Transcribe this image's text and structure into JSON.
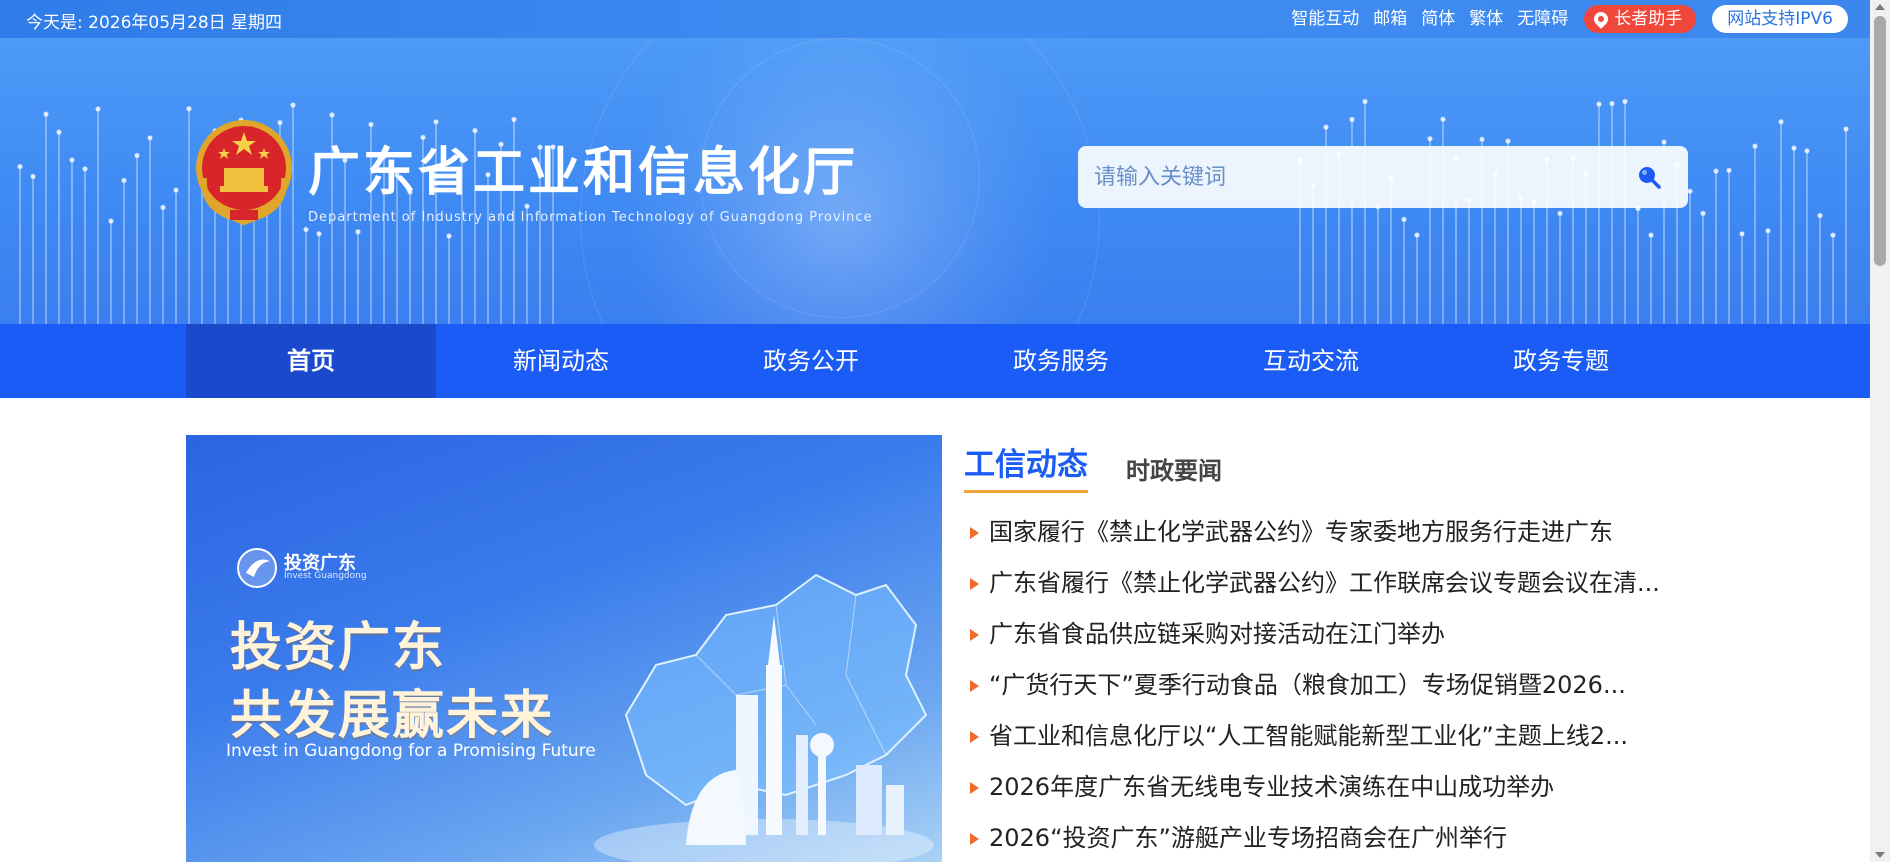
{
  "topbar": {
    "date": "今天是: 2026年05月28日 星期四",
    "links": [
      "智能互动",
      "邮箱",
      "简体",
      "繁体",
      "无障碍"
    ],
    "elder_label": "长者助手",
    "ipv6_label": "网站支持IPV6"
  },
  "header": {
    "title": "广东省工业和信息化厅",
    "subtitle": "Department of Industry and Information Technology of Guangdong Province",
    "search_placeholder": "请输入关键词",
    "search_icon": "search-icon",
    "emblem_icon": "national-emblem-icon"
  },
  "nav": {
    "items": [
      "首页",
      "新闻动态",
      "政务公开",
      "政务服务",
      "互动交流",
      "政务专题"
    ],
    "active_index": 0
  },
  "hero": {
    "logo_cn": "投资广东",
    "logo_en": "Invest Guangdong",
    "line1": "投资广东",
    "line2": "共发展赢未来",
    "en": "Invest in Guangdong for a Promising Future"
  },
  "news": {
    "tab_active": "工信动态",
    "tab_other": "时政要闻",
    "items": [
      "国家履行《禁止化学武器公约》专家委地方服务行走进广东",
      "广东省履行《禁止化学武器公约》工作联席会议专题会议在清...",
      "广东省食品供应链采购对接活动在江门举办",
      "“广货行天下”夏季行动食品（粮食加工）专场促销暨2026...",
      "省工业和信息化厅以“人工智能赋能新型工业化”主题上线2...",
      "2026年度广东省无线电专业技术演练在中山成功举办",
      "2026“投资广东”游艇产业专场招商会在广州举行"
    ]
  },
  "colors": {
    "topbar": "#3a86ee",
    "nav": "#1c5cf6",
    "nav_active": "#1a49cc",
    "accent_orange": "#f1a338",
    "elder_pill": "#f0473a"
  }
}
